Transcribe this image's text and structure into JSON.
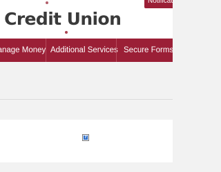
{
  "header": {
    "brand_name": "l Credit Union",
    "notification_tab": "Notifications"
  },
  "nav": {
    "items": [
      {
        "label": "Manage Money"
      },
      {
        "label": "Additional Services"
      },
      {
        "label": "Secure Forms"
      }
    ]
  },
  "content": {
    "broken_image_glyph": "?"
  },
  "colors": {
    "brand_red": "#9b1f36",
    "text_dark": "#3a3a3a",
    "background_gray": "#f2f2f2",
    "content_white": "#ffffff"
  },
  "icons": {
    "broken_image": "broken-image-icon"
  }
}
